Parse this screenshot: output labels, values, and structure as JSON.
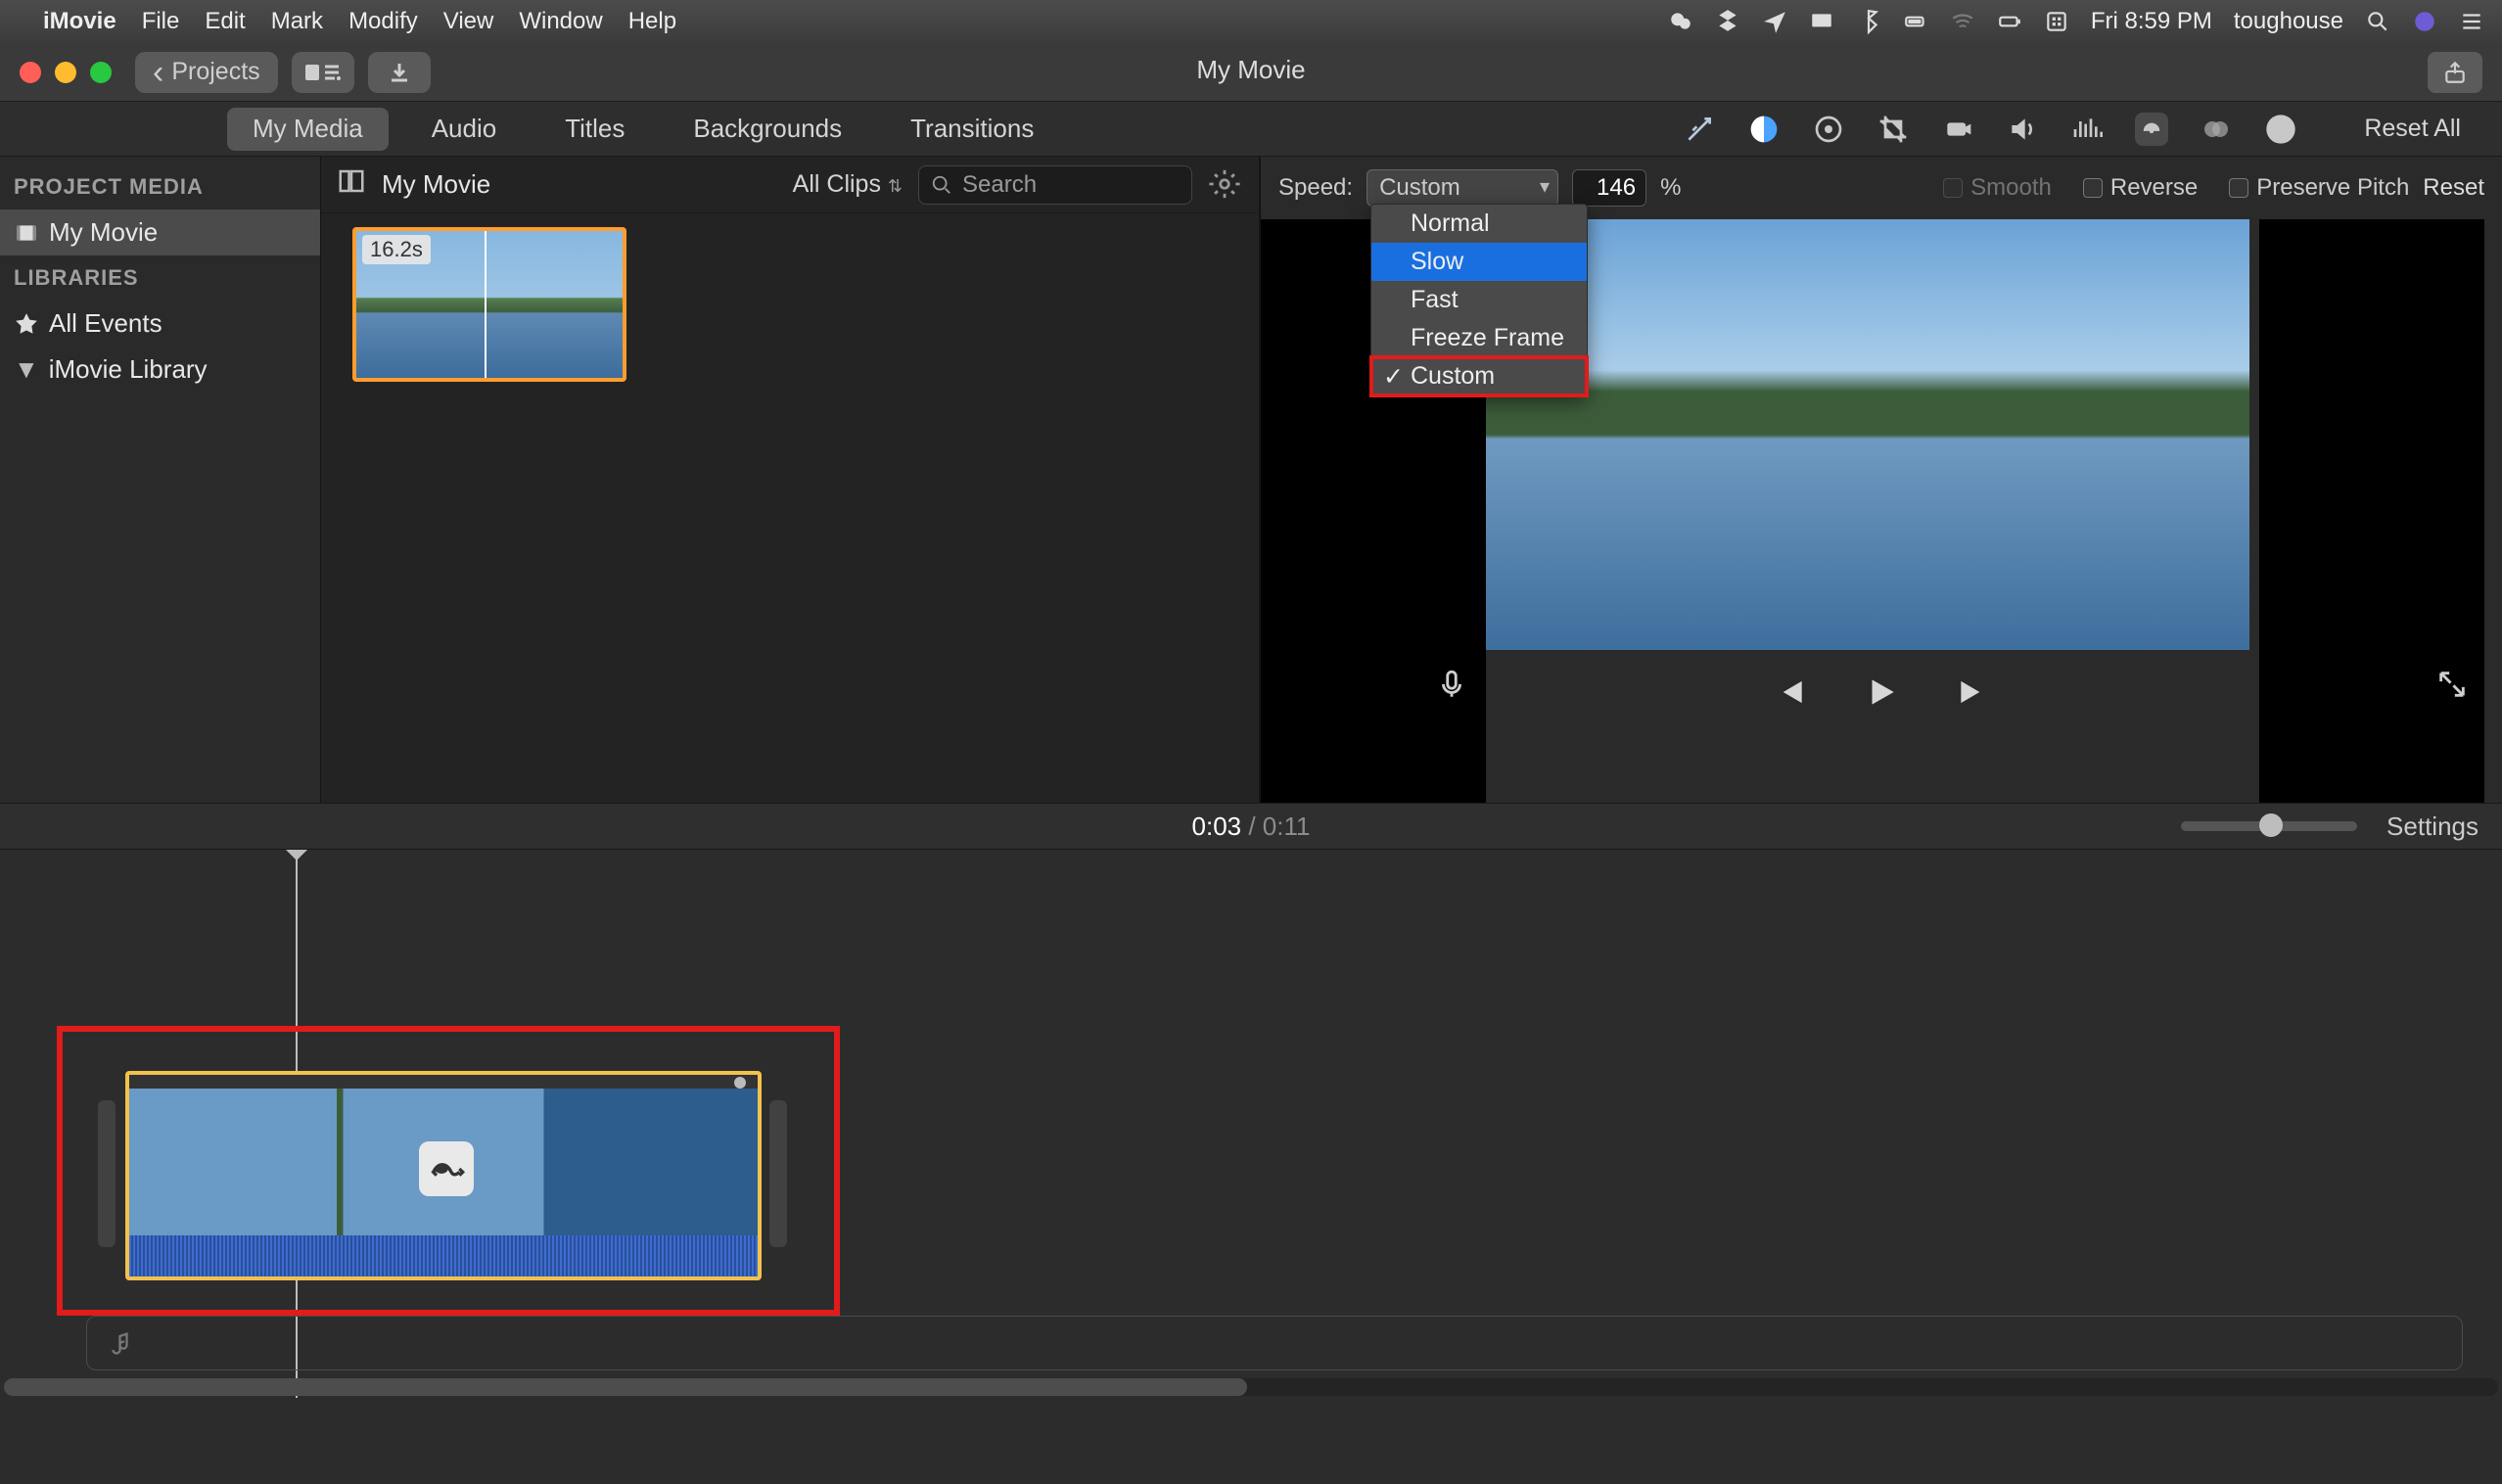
{
  "menubar": {
    "app": "iMovie",
    "items": [
      "File",
      "Edit",
      "Mark",
      "Modify",
      "View",
      "Window",
      "Help"
    ],
    "clock": "Fri 8:59 PM",
    "user": "toughouse"
  },
  "toolbar": {
    "back_label": "Projects",
    "title": "My Movie"
  },
  "tabs": {
    "items": [
      "My Media",
      "Audio",
      "Titles",
      "Backgrounds",
      "Transitions"
    ],
    "active_index": 0,
    "reset_all": "Reset All"
  },
  "sidebar": {
    "project_header": "PROJECT MEDIA",
    "project_item": "My Movie",
    "libraries_header": "LIBRARIES",
    "lib_items": [
      "All Events",
      "iMovie Library"
    ]
  },
  "browser": {
    "breadcrumb": "My Movie",
    "filter": "All Clips",
    "search_placeholder": "Search",
    "clip_duration": "16.2s"
  },
  "inspector": {
    "speed_label": "Speed:",
    "speed_value": "Custom",
    "percent": "146",
    "percent_suffix": "%",
    "smooth": "Smooth",
    "reverse": "Reverse",
    "preserve": "Preserve Pitch",
    "reset": "Reset",
    "dropdown": [
      "Normal",
      "Slow",
      "Fast",
      "Freeze Frame",
      "Custom"
    ],
    "dropdown_highlight_index": 1,
    "dropdown_checked_index": 4
  },
  "timebar": {
    "current": "0:03",
    "sep": " / ",
    "total": "0:11",
    "settings": "Settings"
  },
  "icons": {
    "share": "share-icon",
    "mic": "mic-icon",
    "play": "play-icon",
    "prev": "prev-icon",
    "next": "next-icon",
    "fullscreen": "fullscreen-icon"
  }
}
